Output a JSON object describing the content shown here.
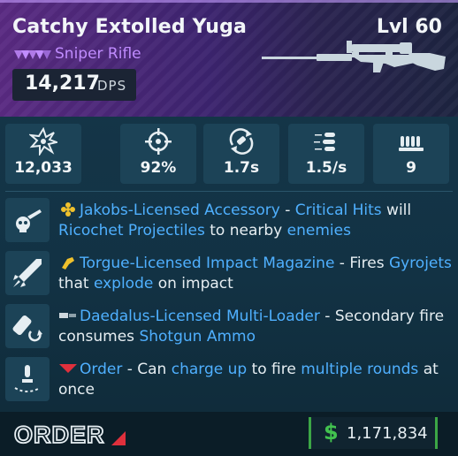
{
  "item": {
    "name": "Catchy Extolled Yuga",
    "level": "Lvl 60",
    "weapon_type": "Sniper Rifle",
    "dps_value": "14,217",
    "dps_label": "DPS",
    "rarity_color": "#c08cff"
  },
  "stats": [
    {
      "icon": "damage-burst-icon",
      "value": "12,033"
    },
    {
      "icon": "crosshair-icon",
      "value": "92%"
    },
    {
      "icon": "reload-icon",
      "value": "1.7s"
    },
    {
      "icon": "fire-rate-bullets-icon",
      "value": "1.5/s"
    },
    {
      "icon": "magazine-icon",
      "value": "9"
    }
  ],
  "perks": [
    {
      "icon": "jakobs-skull-gun-icon",
      "badge": "jakobs-flower-icon",
      "segments": [
        {
          "t": "Jakobs-Licensed Accessory",
          "hl": true
        },
        {
          "t": " - ",
          "hl": false
        },
        {
          "t": "Critical Hits",
          "hl": true
        },
        {
          "t": " will ",
          "hl": false
        },
        {
          "t": "Ricochet Projectiles",
          "hl": true
        },
        {
          "t": " to nearby ",
          "hl": false
        },
        {
          "t": "enemies",
          "hl": true
        }
      ]
    },
    {
      "icon": "torgue-rocket-icon",
      "badge": "torgue-fist-icon",
      "segments": [
        {
          "t": "Torgue-Licensed Impact Magazine",
          "hl": true
        },
        {
          "t": " - Fires ",
          "hl": false
        },
        {
          "t": "Gyrojets",
          "hl": true
        },
        {
          "t": " that ",
          "hl": false
        },
        {
          "t": "explode",
          "hl": true
        },
        {
          "t": " on impact",
          "hl": false
        }
      ]
    },
    {
      "icon": "daedalus-loader-icon",
      "badge": "daedalus-mag-icon",
      "segments": [
        {
          "t": "Daedalus-Licensed Multi-Loader",
          "hl": true
        },
        {
          "t": " - Secondary fire consumes ",
          "hl": false
        },
        {
          "t": "Shotgun Ammo",
          "hl": true
        }
      ]
    },
    {
      "icon": "order-charge-icon",
      "badge": "order-chevron-icon",
      "segments": [
        {
          "t": "Order",
          "hl": true
        },
        {
          "t": " - Can ",
          "hl": false
        },
        {
          "t": "charge up",
          "hl": true
        },
        {
          "t": " to fire ",
          "hl": false
        },
        {
          "t": "multiple rounds",
          "hl": true
        },
        {
          "t": " at once",
          "hl": false
        }
      ]
    }
  ],
  "footer": {
    "manufacturer_logo": "ORDER",
    "currency_symbol": "$",
    "price": "1,171,834"
  },
  "colors": {
    "highlight": "#4fb0ff",
    "price_green": "#42c24f"
  }
}
